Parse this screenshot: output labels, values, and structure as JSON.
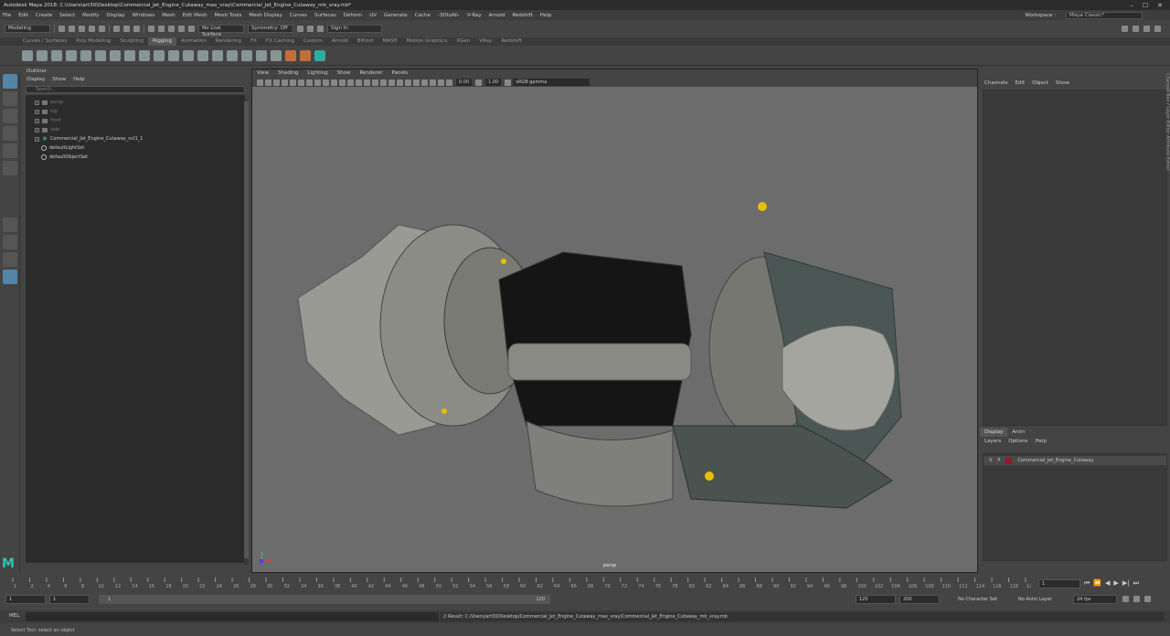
{
  "title": "Autodesk Maya 2018: C:\\Users\\art30\\Desktop\\Commercial_Jet_Engine_Cutaway_max_vray\\Commercial_Jet_Engine_Cutaway_mb_vray.mb*",
  "menus": [
    "File",
    "Edit",
    "Create",
    "Select",
    "Modify",
    "Display",
    "Windows",
    "Mesh",
    "Edit Mesh",
    "Mesh Tools",
    "Mesh Display",
    "Curves",
    "Surfaces",
    "Deform",
    "UV",
    "Generate",
    "Cache",
    "-3DtoAll-",
    "V-Ray",
    "Arnold",
    "Redshift",
    "Help"
  ],
  "workspace": {
    "label": "Workspace :",
    "value": "Maya Classic*"
  },
  "status": {
    "mode": "Modeling",
    "live_surface": "No Live Surface",
    "symmetry": "Symmetry: Off",
    "sign_in": "Sign In"
  },
  "shelf_tabs": [
    "Curves / Surfaces",
    "Poly Modeling",
    "Sculpting",
    "Rigging",
    "Animation",
    "Rendering",
    "FX",
    "FX Caching",
    "Custom",
    "Arnold",
    "Bifrost",
    "MASH",
    "Motion Graphics",
    "XGen",
    "VRay",
    "Redshift"
  ],
  "active_shelf": "Rigging",
  "outliner": {
    "title": "Outliner",
    "menu": [
      "Display",
      "Show",
      "Help"
    ],
    "search_placeholder": "Search...",
    "items": [
      {
        "label": "persp",
        "kind": "camera",
        "dim": true
      },
      {
        "label": "top",
        "kind": "camera",
        "dim": true
      },
      {
        "label": "front",
        "kind": "camera",
        "dim": true
      },
      {
        "label": "side",
        "kind": "camera",
        "dim": true
      },
      {
        "label": "Commercial_Jet_Engine_Cutaway_ncl1_1",
        "kind": "group",
        "dim": false
      },
      {
        "label": "defaultLightSet",
        "kind": "set",
        "dim": false
      },
      {
        "label": "defaultObjectSet",
        "kind": "set",
        "dim": false
      }
    ]
  },
  "viewport": {
    "menu": [
      "View",
      "Shading",
      "Lighting",
      "Show",
      "Renderer",
      "Panels"
    ],
    "exposure": "0.00",
    "gamma": "1.00",
    "colorspace": "sRGB gamma",
    "camera": "persp"
  },
  "channels": {
    "menu": [
      "Channels",
      "Edit",
      "Object",
      "Show"
    ],
    "side_tabs": "Channel Box / Layer Editor    Attribute Editor"
  },
  "layers": {
    "tabs": [
      "Display",
      "Anim"
    ],
    "menu": [
      "Layers",
      "Options",
      "Help"
    ],
    "row": {
      "v": "V",
      "p": "P",
      "name": "Commercial_Jet_Engine_Cutaway",
      "color": "#a0142a"
    }
  },
  "timeline": {
    "ticks": [
      "1",
      "2",
      "4",
      "6",
      "8",
      "10",
      "12",
      "14",
      "16",
      "18",
      "20",
      "22",
      "24",
      "26",
      "28",
      "30",
      "32",
      "34",
      "36",
      "38",
      "40",
      "42",
      "44",
      "46",
      "48",
      "50",
      "52",
      "54",
      "56",
      "58",
      "60",
      "62",
      "64",
      "66",
      "68",
      "70",
      "72",
      "74",
      "76",
      "78",
      "80",
      "82",
      "84",
      "86",
      "88",
      "90",
      "92",
      "94",
      "96",
      "98",
      "100",
      "102",
      "104",
      "106",
      "108",
      "110",
      "112",
      "114",
      "116",
      "118",
      "120"
    ],
    "current": "1"
  },
  "range": {
    "start": "1",
    "start2": "1",
    "slider_start": "1",
    "slider_end": "120",
    "end": "120",
    "end2": "200",
    "character": "No Character Set",
    "anim_layer": "No Anim Layer",
    "fps": "24 fps"
  },
  "cmd": {
    "lang": "MEL",
    "result": "// Result: C:/Users/art30/Desktop/Commercial_Jet_Engine_Cutaway_max_vray/Commercial_Jet_Engine_Cutaway_mb_vray.mb"
  },
  "help_line": "Select Tool: select an object"
}
